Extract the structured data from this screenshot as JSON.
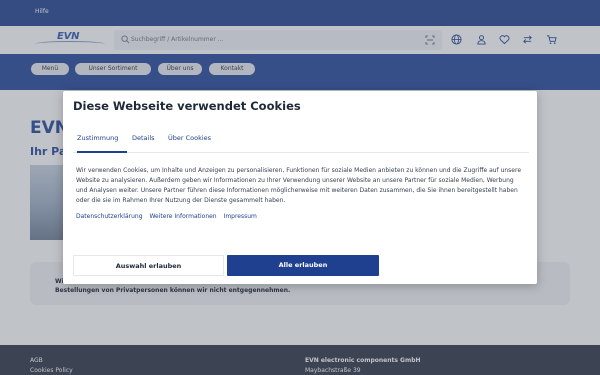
{
  "topbar": {
    "help_label": "Hilfe"
  },
  "header": {
    "logo_text": "EVN",
    "search_placeholder": "Suchbegriff / Artikelnummer ..."
  },
  "nav": {
    "items": [
      {
        "label": "Menü"
      },
      {
        "label": "Unser Sortiment"
      },
      {
        "label": "Über uns"
      },
      {
        "label": "Kontakt"
      }
    ]
  },
  "page": {
    "title_partial": "EVN",
    "subtitle_partial": "Ihr Pa",
    "notice_line1": "Wi",
    "notice_line2": "Bestellungen von Privatpersonen können wir nicht entgegennehmen."
  },
  "footer": {
    "left_links": [
      "AGB",
      "Cookies Policy"
    ],
    "company_name": "EVN electronic components GmbH",
    "street": "Maybachstraße 39"
  },
  "cookie_dialog": {
    "title": "Diese Webseite verwendet Cookies",
    "tabs": [
      {
        "label": "Zustimmung"
      },
      {
        "label": "Details"
      },
      {
        "label": "Über Cookies"
      }
    ],
    "body": "Wir verwenden Cookies, um Inhalte und Anzeigen zu personalisieren, Funktionen für soziale Medien anbieten zu können und die Zugriffe auf unsere Website zu analysieren. Außerdem geben wir Informationen zu Ihrer Verwendung unserer Website an unsere Partner für soziale Medien, Werbung und Analysen weiter. Unsere Partner führen diese Informationen möglicherweise mit weiteren Daten zusammen, die Sie ihnen bereitgestellt haben oder die sie im Rahmen Ihrer Nutzung der Dienste gesammelt haben.",
    "links": [
      {
        "label": "Datenschutzerklärung"
      },
      {
        "label": "Weitere Informationen"
      },
      {
        "label": "Impressum"
      }
    ],
    "btn_selection": "Auswahl erlauben",
    "btn_all": "Alle erlauben"
  },
  "colors": {
    "brand_blue": "#21459a",
    "dark_blue": "#1f3f8f",
    "footer_bg": "#2a3344"
  }
}
